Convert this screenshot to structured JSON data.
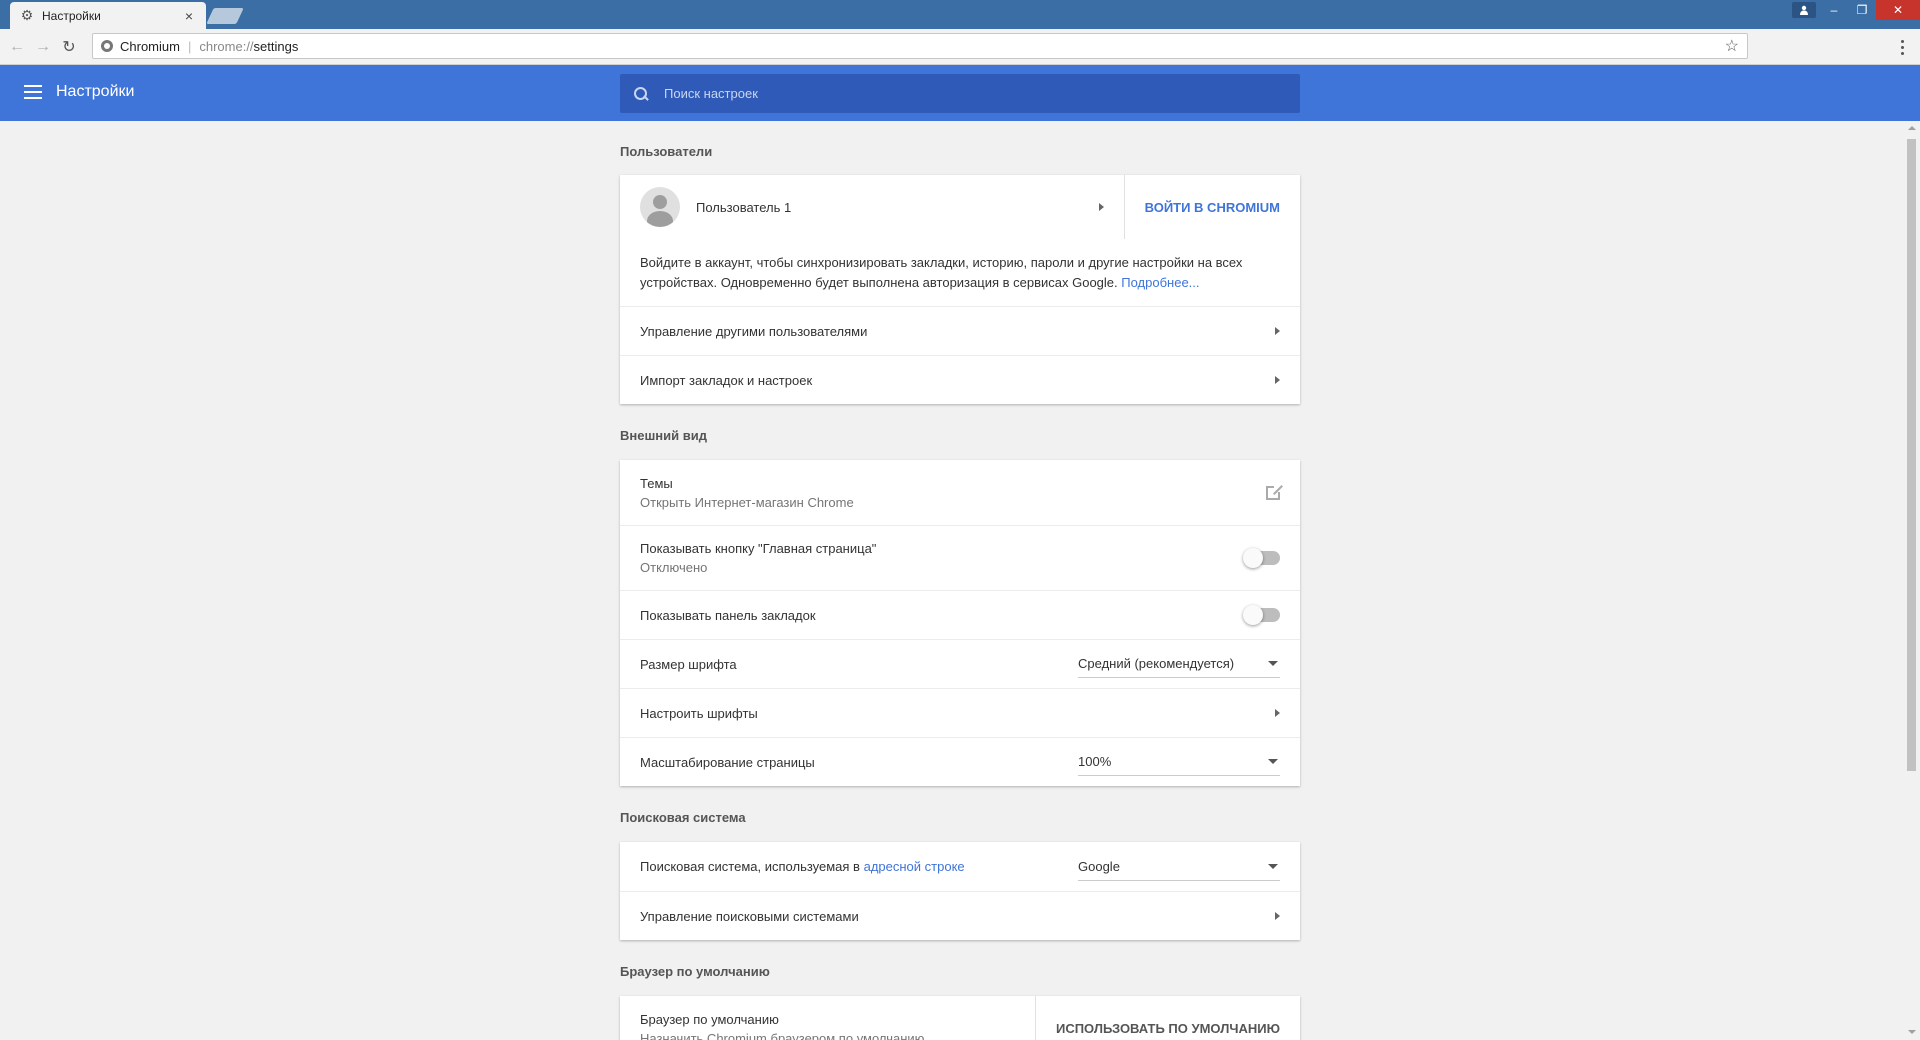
{
  "window": {
    "tab_title": "Настройки",
    "tab_close": "×",
    "controls": {
      "minimize": "–",
      "maximize": "❐",
      "close": "✕",
      "profile": "👤"
    }
  },
  "toolbar": {
    "back": "←",
    "forward": "→",
    "reload": "↻",
    "site_name": "Chromium",
    "url_separator": "|",
    "url_scheme": "chrome://",
    "url_path": "settings",
    "bookmark_star": "☆"
  },
  "header": {
    "title": "Настройки",
    "search_placeholder": "Поиск настроек"
  },
  "sections": {
    "people": {
      "title": "Пользователи",
      "user_name": "Пользователь 1",
      "signin_button": "ВОЙТИ В CHROMIUM",
      "description": "Войдите в аккаунт, чтобы синхронизировать закладки, историю, пароли и другие настройки на всех устройствах. Одновременно будет выполнена авторизация в сервисах Google.",
      "learn_more": "Подробнее...",
      "manage_users": "Управление другими пользователями",
      "import": "Импорт закладок и настроек"
    },
    "appearance": {
      "title": "Внешний вид",
      "themes_label": "Темы",
      "themes_sub": "Открыть Интернет-магазин Chrome",
      "home_button_label": "Показывать кнопку \"Главная страница\"",
      "home_button_sub": "Отключено",
      "bookmarks_bar_label": "Показывать панель закладок",
      "font_size_label": "Размер шрифта",
      "font_size_value": "Средний (рекомендуется)",
      "customize_fonts": "Настроить шрифты",
      "zoom_label": "Масштабирование страницы",
      "zoom_value": "100%"
    },
    "search": {
      "title": "Поисковая система",
      "engine_label_prefix": "Поисковая система, используемая в",
      "engine_label_link": "адресной строке",
      "engine_value": "Google",
      "manage_engines": "Управление поисковыми системами"
    },
    "default_browser": {
      "title": "Браузер по умолчанию",
      "label": "Браузер по умолчанию",
      "sub": "Назначить Chromium браузером по умолчанию",
      "button": "ИСПОЛЬЗОВАТЬ ПО УМОЛЧАНИЮ"
    }
  },
  "colors": {
    "titlebar": "#3a6ea5",
    "header": "#3f74d9",
    "search_bg": "#2f5ab8",
    "link": "#3f74d9",
    "close_button": "#c7342b"
  }
}
